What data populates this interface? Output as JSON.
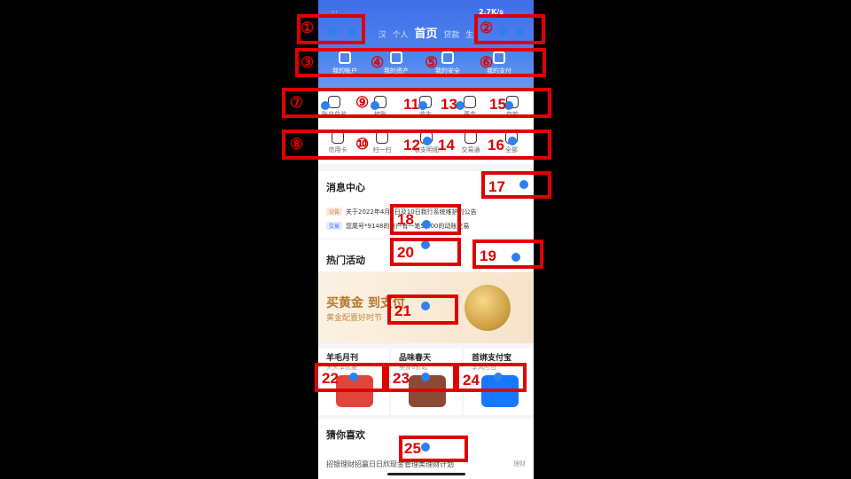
{
  "status": {
    "dots": "···",
    "speed": "2.7K/s"
  },
  "tabs": [
    "汉",
    "个人",
    "首页",
    "贷款",
    "生"
  ],
  "top_icons": [
    {
      "label": "我的账户",
      "icon": "account-icon"
    },
    {
      "label": "我的资产",
      "icon": "wallet-icon"
    },
    {
      "label": "我的安全",
      "icon": "shield-icon"
    },
    {
      "label": "我的支付",
      "icon": "pay-icon"
    }
  ],
  "grid_row1": [
    {
      "label": "账户总览",
      "icon": "overview-icon"
    },
    {
      "label": "转账",
      "icon": "transfer-icon"
    },
    {
      "label": "收支",
      "icon": "income-icon"
    },
    {
      "label": "基金",
      "icon": "fund-icon"
    },
    {
      "label": "存款",
      "icon": "deposit-icon"
    }
  ],
  "grid_row2": [
    {
      "label": "信用卡",
      "icon": "creditcard-icon"
    },
    {
      "label": "扫一扫",
      "icon": "scan-icon"
    },
    {
      "label": "收支明细",
      "icon": "detail-icon"
    },
    {
      "label": "交易通",
      "icon": "trade-icon"
    },
    {
      "label": "全部",
      "icon": "all-icon"
    }
  ],
  "messages": {
    "title": "消息中心",
    "items": [
      {
        "tag": "公告",
        "text": "关于2022年4月9日及10日我行系统维护的公告"
      },
      {
        "tag": "交易",
        "text": "您尾号*9148的账户有一笔50.00的动账交易"
      }
    ]
  },
  "hot": {
    "title": "热门活动",
    "banner_title": "买黄金 到支付",
    "banner_sub": "黄金配置好时节"
  },
  "promos": [
    {
      "title": "羊毛月刊",
      "sub": "天天享优惠"
    },
    {
      "title": "品味春天",
      "sub": "美食8折起"
    },
    {
      "title": "首绑支付宝",
      "sub": "享风险包"
    }
  ],
  "guess": {
    "title": "猜你喜欢",
    "item": "招银理财招赢日日欣现金管理类理财计划",
    "tag": "理财"
  },
  "annotations": [
    "①",
    "②",
    "③",
    "④",
    "⑤",
    "⑥",
    "⑦",
    "⑧",
    "⑨",
    "⑩",
    "11",
    "12",
    "13",
    "14",
    "15",
    "16",
    "17",
    "18",
    "19",
    "20",
    "21",
    "22",
    "23",
    "24",
    "25"
  ]
}
